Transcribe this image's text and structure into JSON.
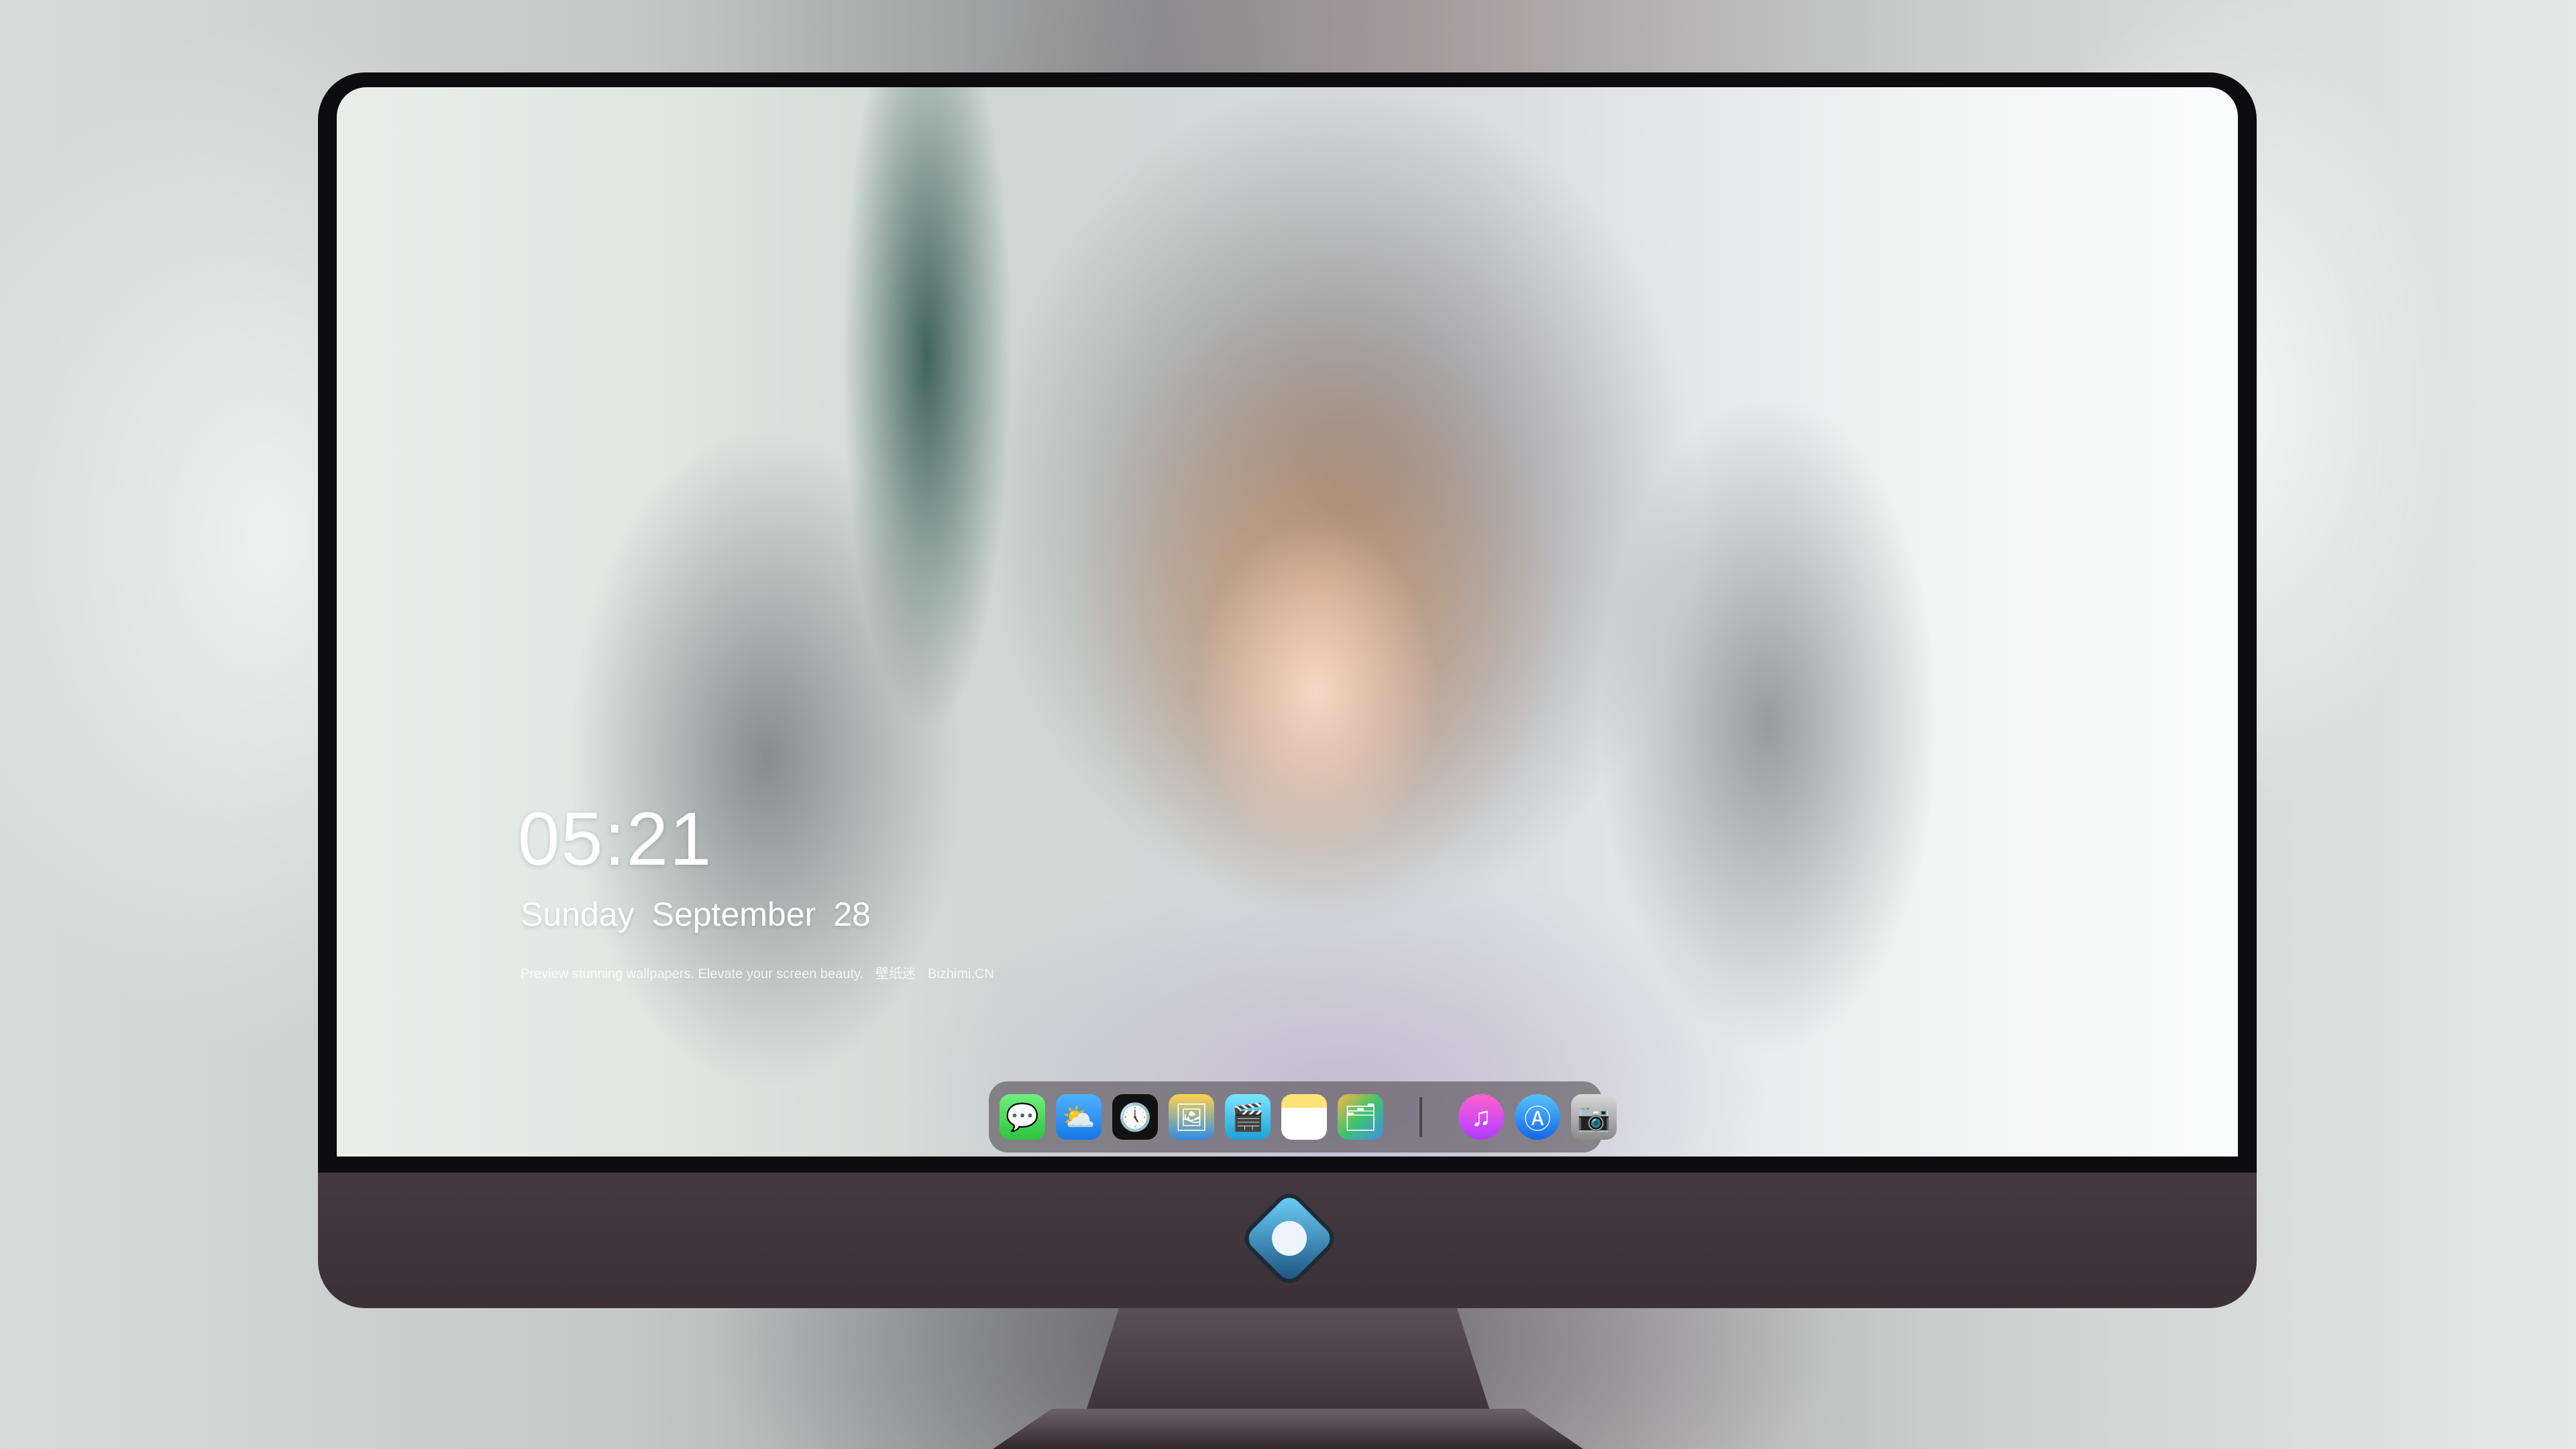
{
  "lockscreen": {
    "time": "05:21",
    "weekday": "Sunday",
    "month": "September",
    "day": "28",
    "tagline": "Preview stunning wallpapers. Elevate your screen beauty.",
    "brand_cn": "壁纸迷",
    "brand_site": "Bizhimi.CN"
  },
  "dock": {
    "apps": [
      {
        "name": "messages-icon",
        "glyph": "💬"
      },
      {
        "name": "weather-icon",
        "glyph": "⛅"
      },
      {
        "name": "clock-icon",
        "glyph": "🕔"
      },
      {
        "name": "preview-icon",
        "glyph": "🖼"
      },
      {
        "name": "clips-icon",
        "glyph": "🎬"
      },
      {
        "name": "notes-icon",
        "glyph": ""
      },
      {
        "name": "photos-icon",
        "glyph": "🗂"
      },
      {
        "name": "itunes-icon",
        "glyph": "♫"
      },
      {
        "name": "app-store-icon",
        "glyph": "Ⓐ"
      },
      {
        "name": "camera-icon",
        "glyph": "📷"
      }
    ]
  }
}
